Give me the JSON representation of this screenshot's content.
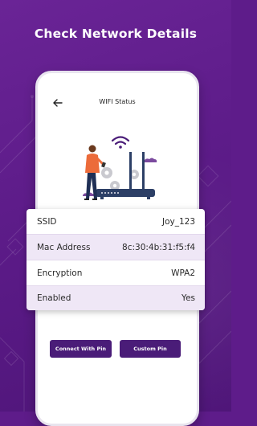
{
  "promo": {
    "headline": "Check Network Details"
  },
  "screen": {
    "title": "WIFI Status",
    "icons": {
      "back": "arrow-left-icon",
      "illustration": "person-router-illustration"
    },
    "details": [
      {
        "label": "SSID",
        "value": "Joy_123"
      },
      {
        "label": "Mac Address",
        "value": "8c:30:4b:31:f5:f4"
      },
      {
        "label": "Encryption",
        "value": "WPA2"
      },
      {
        "label": "Enabled",
        "value": "Yes"
      }
    ],
    "buttons": {
      "connect_with_pin": "Connect With Pin",
      "custom_pin": "Custom Pin"
    }
  },
  "colors": {
    "background": "#5e1c8a",
    "accent": "#4a1c78",
    "row_shade": "#efe7f6"
  }
}
